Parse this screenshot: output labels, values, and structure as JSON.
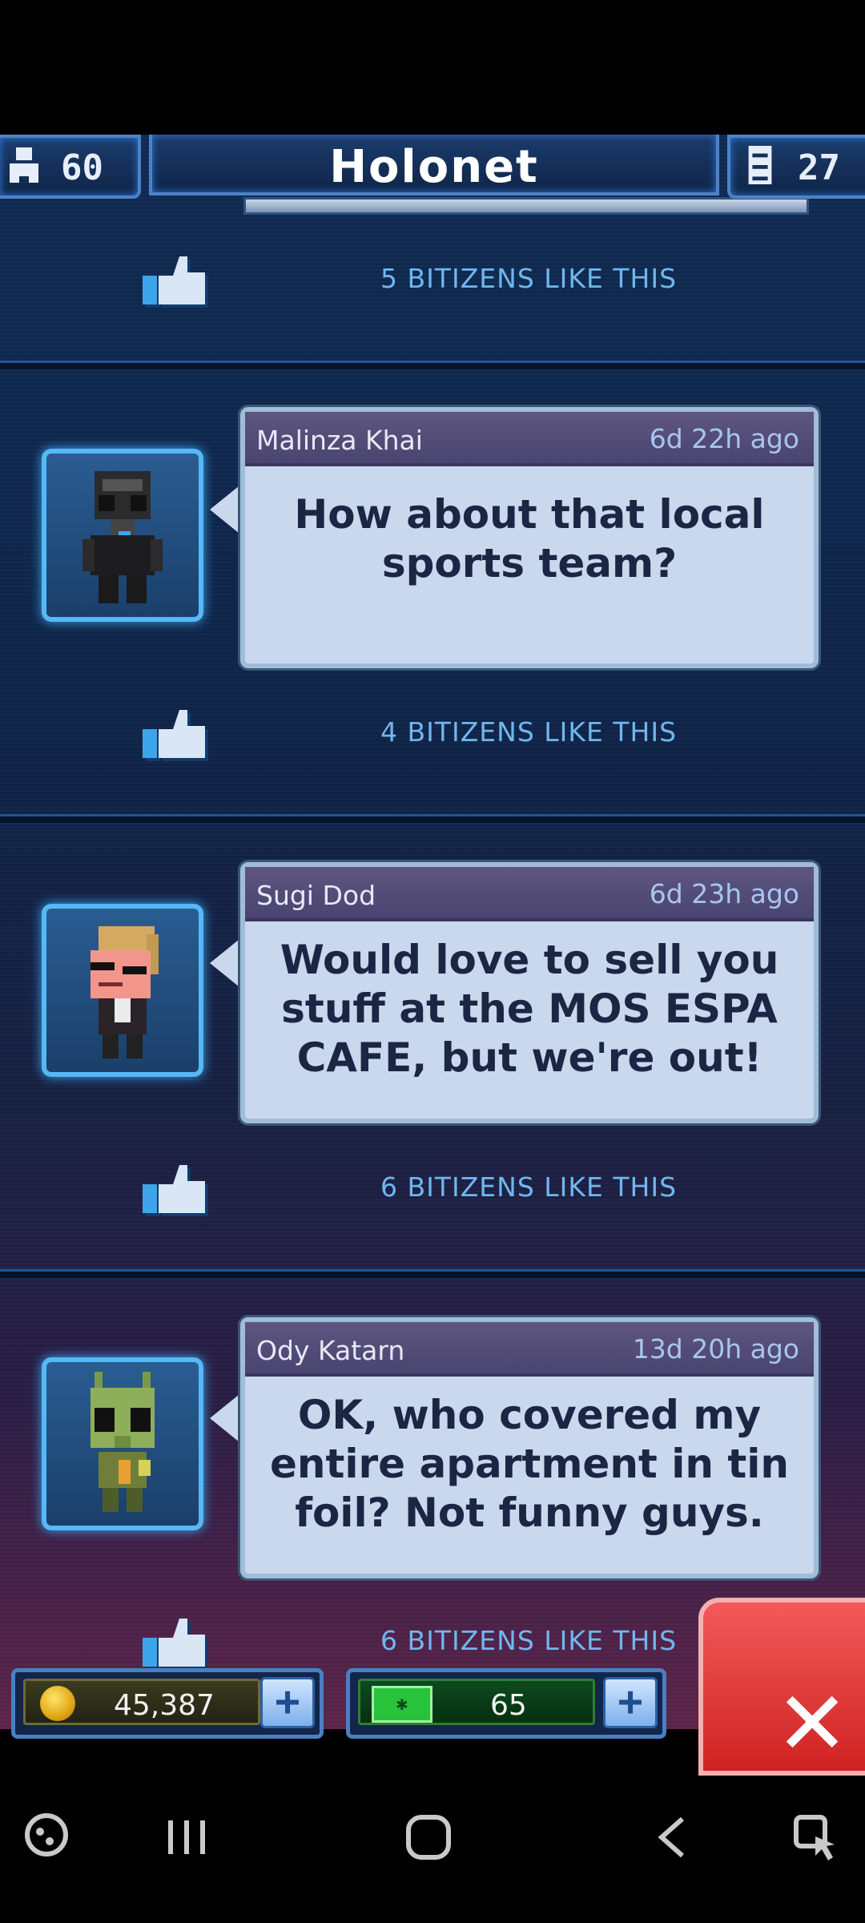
{
  "header": {
    "population": "60",
    "title": "Holonet",
    "floors": "27"
  },
  "top_likes": "5 BITIZENS LIKE THIS",
  "posts": [
    {
      "author": "Malinza Khai",
      "time": "6d 22h ago",
      "message": "How about that local sports team?",
      "likes": "4 BITIZENS LIKE THIS",
      "avatar": "tie-pilot-avatar"
    },
    {
      "author": "Sugi Dod",
      "time": "6d 23h ago",
      "message": "Would love to sell you stuff at the MOS ESPA CAFE, but we're out!",
      "likes": "6 BITIZENS LIKE THIS",
      "avatar": "blonde-bitizen-avatar"
    },
    {
      "author": "Ody Katarn",
      "time": "13d 20h ago",
      "message": "OK, who covered my entire apartment in tin foil? Not funny guys.",
      "likes": "6 BITIZENS LIKE THIS",
      "avatar": "rodian-avatar"
    }
  ],
  "bottom": {
    "coins": "45,387",
    "bux": "65",
    "plus": "+",
    "close": "✕"
  },
  "colors": {
    "accent": "#56b8f6",
    "like_text": "#6fb7ee",
    "bubble": "#c9d8ec",
    "close_red": "#e03a3a"
  }
}
